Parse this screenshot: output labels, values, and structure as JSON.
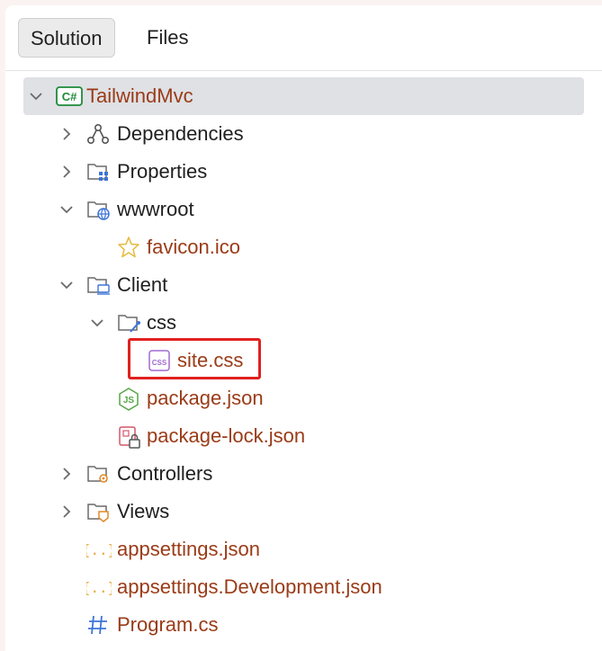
{
  "tabs": {
    "solution": "Solution",
    "files": "Files"
  },
  "tree": {
    "project": "TailwindMvc",
    "project_badge": "C#",
    "dependencies": "Dependencies",
    "properties": "Properties",
    "wwwroot": "wwwroot",
    "favicon": "favicon.ico",
    "client": "Client",
    "css_folder": "css",
    "site_css": "site.css",
    "css_badge": "CSS",
    "package_json": "package.json",
    "package_lock": "package-lock.json",
    "controllers": "Controllers",
    "views": "Views",
    "appsettings": "appsettings.json",
    "appsettings_dev": "appsettings.Development.json",
    "program": "Program.cs"
  },
  "colors": {
    "highlight": "#e0201f",
    "file_text": "#9a3b17",
    "folder_text": "#1f1f1f",
    "selected_row": "#dfe1e5"
  }
}
